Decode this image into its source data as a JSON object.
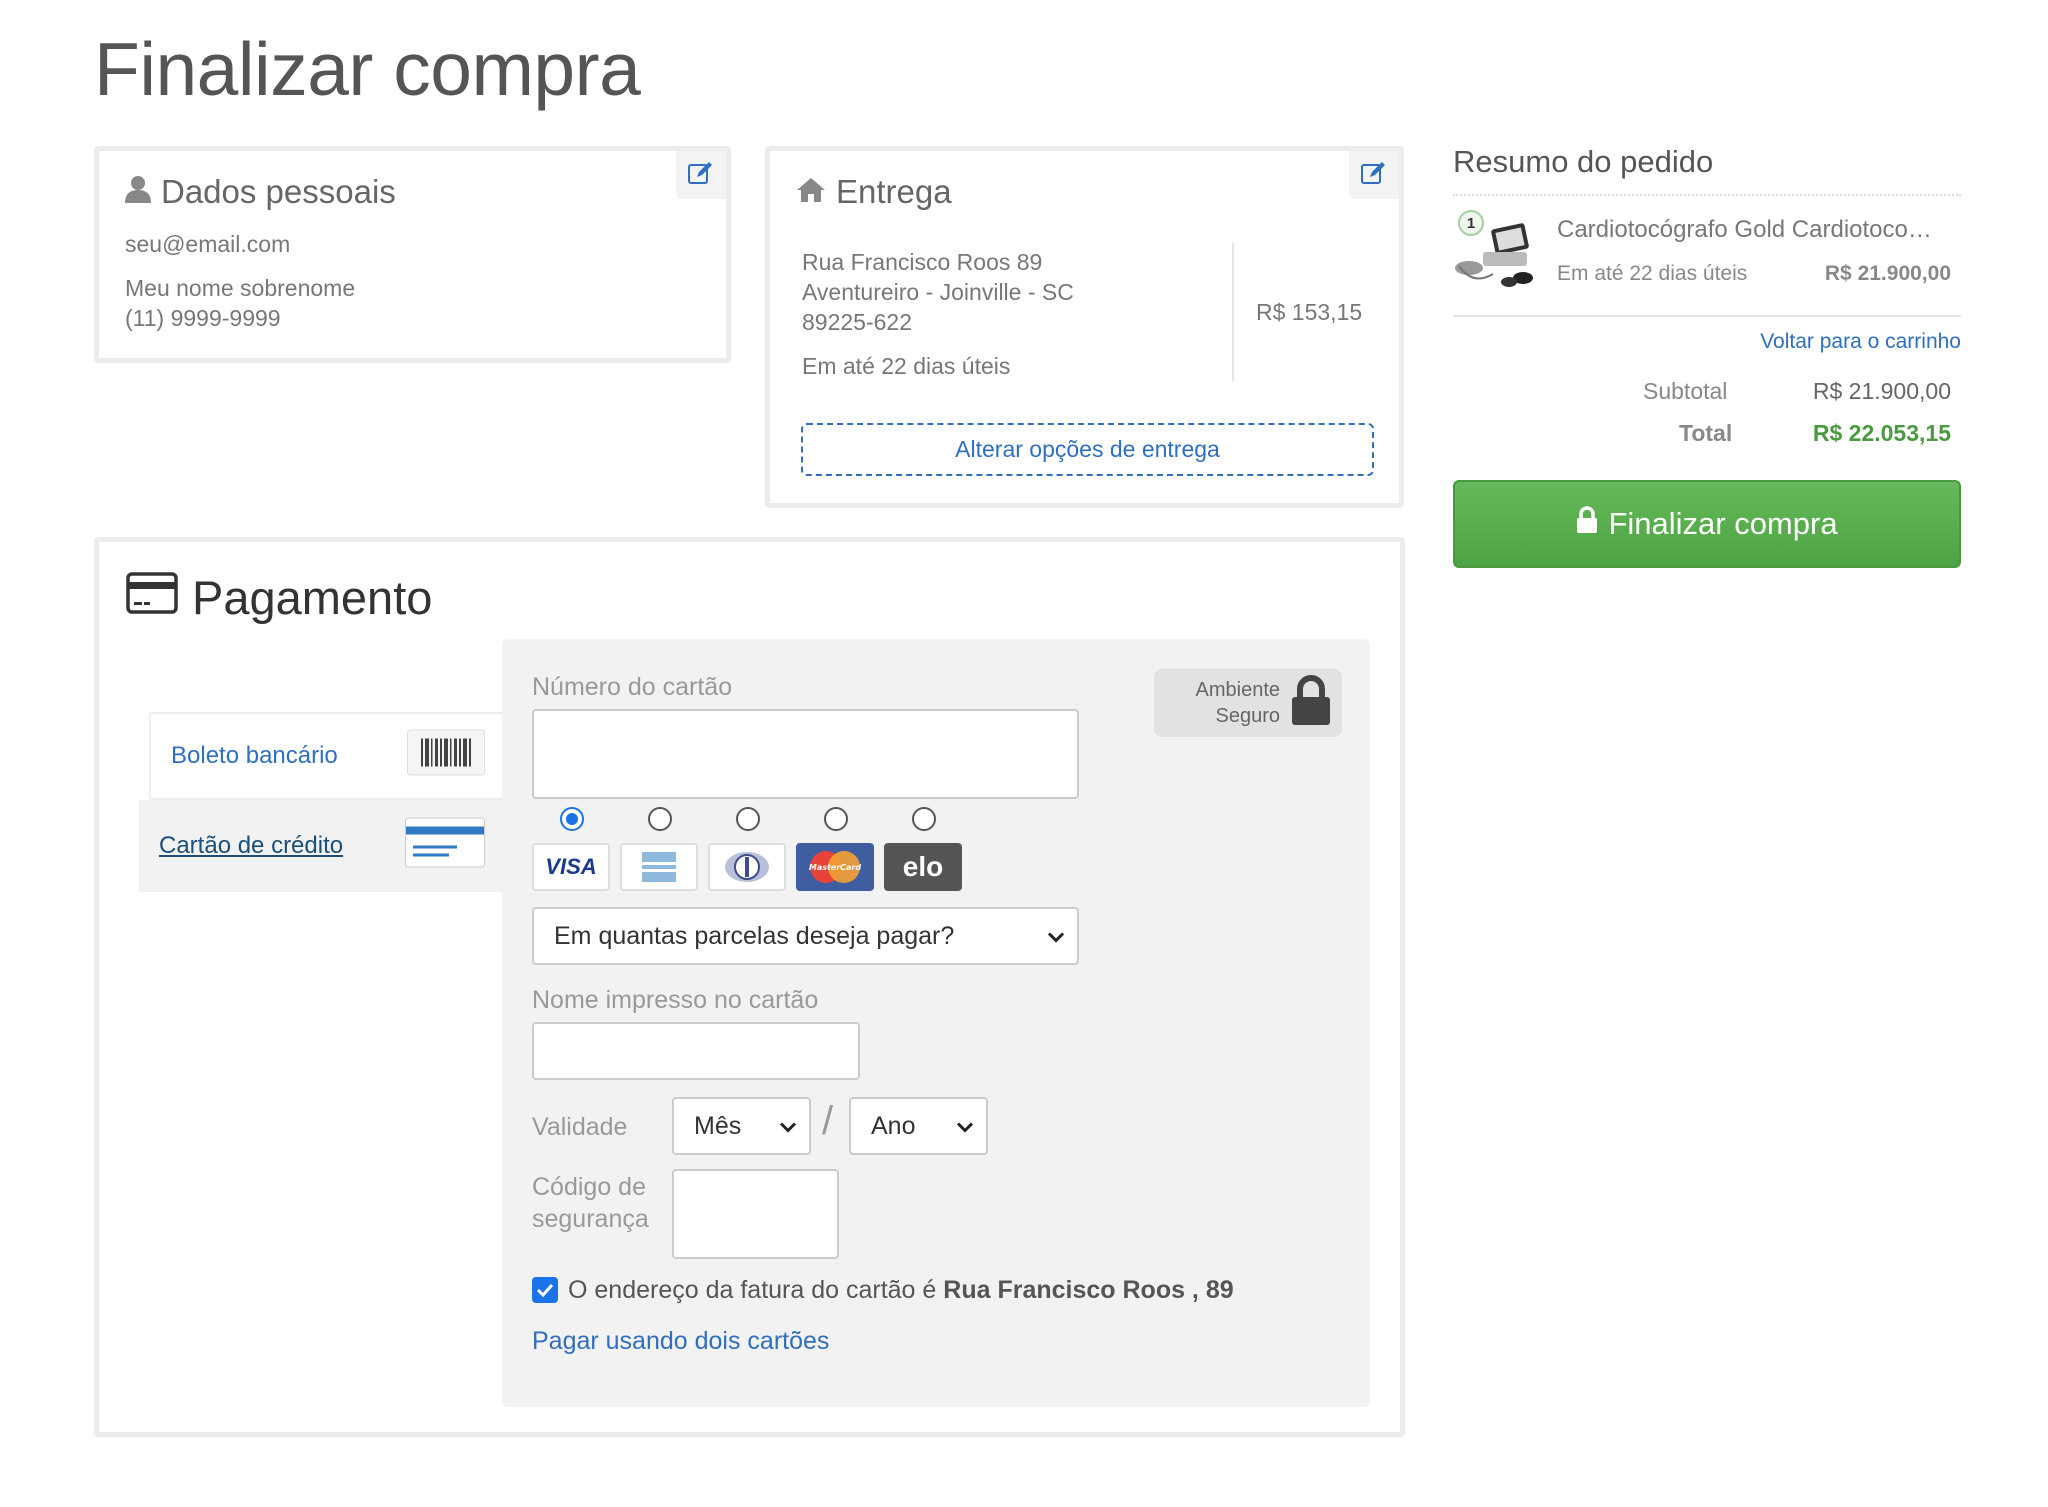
{
  "page": {
    "title": "Finalizar compra"
  },
  "personal": {
    "title": "Dados pessoais",
    "email": "seu@email.com",
    "name": "Meu nome sobrenome",
    "phone": "(11) 9999-9999"
  },
  "delivery": {
    "title": "Entrega",
    "street": "Rua Francisco Roos 89",
    "district": "Aventureiro - Joinville - SC",
    "zip": "89225-622",
    "eta": "Em até 22 dias úteis",
    "price": "R$ 153,15",
    "change_label": "Alterar opções de entrega"
  },
  "summary": {
    "title": "Resumo do pedido",
    "item": {
      "qty": "1",
      "name": "Cardiotocógrafo Gold Cardiotoco…",
      "eta": "Em até 22 dias úteis",
      "price": "R$ 21.900,00"
    },
    "back_link": "Voltar para o carrinho",
    "subtotal_label": "Subtotal",
    "subtotal": "R$ 21.900,00",
    "total_label": "Total",
    "total": "R$ 22.053,15",
    "finish_label": "Finalizar compra",
    "total_color": "#4a9a3f"
  },
  "payment": {
    "title": "Pagamento",
    "methods": [
      {
        "label": "Boleto bancário",
        "icon": "barcode-icon"
      },
      {
        "label": "Cartão de crédito",
        "icon": "credit-card-icon",
        "selected": true
      }
    ],
    "card_number_label": "Número do cartão",
    "secure_label_1": "Ambiente",
    "secure_label_2": "Seguro",
    "brands": [
      {
        "name": "visa",
        "text": "VISA",
        "selected": true
      },
      {
        "name": "amex",
        "text": ""
      },
      {
        "name": "diners",
        "text": ""
      },
      {
        "name": "mastercard",
        "text": "MasterCard"
      },
      {
        "name": "elo",
        "text": "elo"
      }
    ],
    "installments_placeholder": "Em quantas parcelas deseja pagar?",
    "cardholder_label": "Nome impresso no cartão",
    "expiry_label": "Validade",
    "month_placeholder": "Mês",
    "year_placeholder": "Ano",
    "slash": "/",
    "cvv_label_1": "Código de",
    "cvv_label_2": "segurança",
    "billing_prefix": "O endereço da fatura do cartão é",
    "billing_address": "Rua Francisco Roos , 89",
    "billing_checked": true,
    "two_cards_label": "Pagar usando dois cartões"
  }
}
